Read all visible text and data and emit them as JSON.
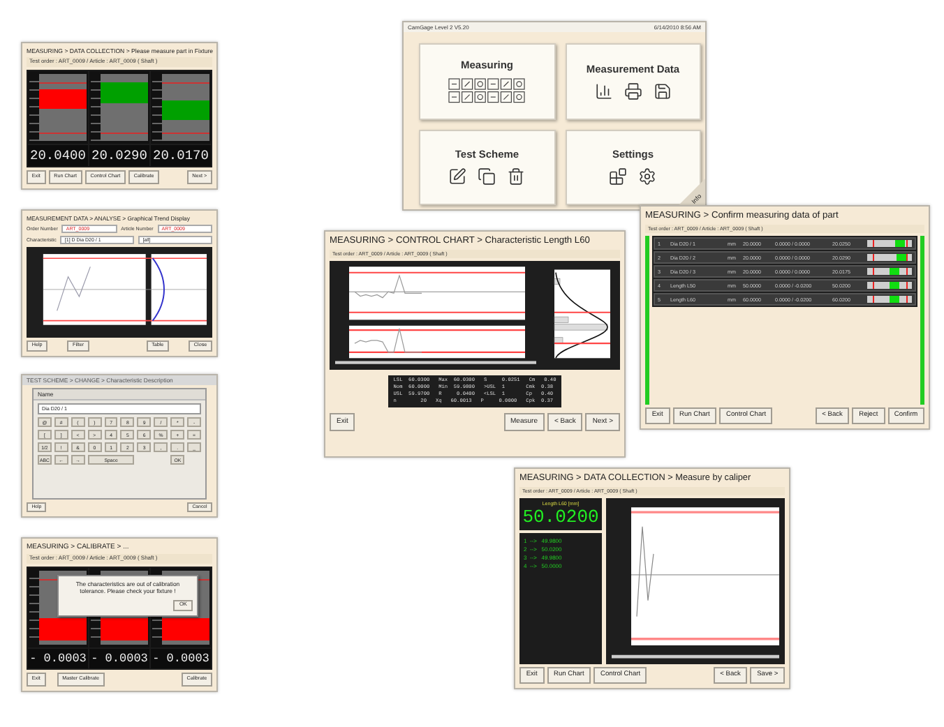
{
  "gauge_window": {
    "title": "MEASURING > DATA COLLECTION > Please measure part in Fixture",
    "order_line": "Test order : ART_0009 / Article : ART_0009 ( Shaft )",
    "gauges": [
      {
        "value": "20.0400",
        "color": "#ff0000",
        "level": 0.62
      },
      {
        "value": "20.0290",
        "color": "#00a000",
        "level": 0.72
      },
      {
        "value": "20.0170",
        "color": "#00a000",
        "level": 0.46
      }
    ],
    "buttons": [
      "Exit",
      "Run Chart",
      "Control Chart",
      "Calibrate",
      "Next >"
    ]
  },
  "main_menu": {
    "title": "CamGage Level 2  V5.20",
    "datetime": "6/14/2010  8:56 AM",
    "tiles": [
      {
        "kind": "measuring",
        "label": "Measuring"
      },
      {
        "kind": "data",
        "label": "Measurement Data"
      },
      {
        "kind": "scheme",
        "label": "Test Scheme"
      },
      {
        "kind": "settings",
        "label": "Settings"
      }
    ],
    "info": "Info"
  },
  "trend_window": {
    "title": "MEASUREMENT DATA > ANALYSE > Graphical Trend Display",
    "order_label": "Order Number",
    "order_value": "ART_0009",
    "article_label": "Article Number",
    "article_value": "ART_0009",
    "characteristic_label": "Characteristic",
    "characteristic_value": "[1] D Dia D20 / 1",
    "filter_value": "[all]",
    "buttons": [
      "Help",
      "Filter",
      "Table",
      "Close"
    ]
  },
  "control_chart": {
    "title": "MEASURING > CONTROL CHART > Characteristic Length L60",
    "order_line": "Test order : ART_0009 / Article : ART_0009 ( Shaft )",
    "stats": [
      "LSL  60.0300   Max  60.0300   S     0.0251   Cm   0.40",
      "Nom  60.0000   Min  59.9800   >USL  1       Cmk  0.38",
      "USL  59.9700   R     0.0400   <LSL  1       Cp   0.40",
      "n        20   Xq   60.0013   P     0.0000   Cpk  0.37"
    ],
    "buttons": [
      "Exit",
      "Measure",
      "< Back",
      "Next >"
    ]
  },
  "confirm": {
    "title": "MEASURING >  Confirm measuring data of part",
    "order_line": "Test order : ART_0009 / Article : ART_0009 ( Shaft )",
    "rows": [
      {
        "number": "1",
        "name": "Dia D20 / 1",
        "unit": "mm",
        "nominal": "20.0000",
        "tolerance": "0.0000 / 0.0000",
        "value": "20.0250",
        "level": 0.72
      },
      {
        "number": "2",
        "name": "Dia D20 / 2",
        "unit": "mm",
        "nominal": "20.0000",
        "tolerance": "0.0000 / 0.0000",
        "value": "20.0290",
        "level": 0.78
      },
      {
        "number": "3",
        "name": "Dia D20 / 3",
        "unit": "mm",
        "nominal": "20.0000",
        "tolerance": "0.0000 / 0.0000",
        "value": "20.0175",
        "level": 0.6
      },
      {
        "number": "4",
        "name": "Length L50",
        "unit": "mm",
        "nominal": "50.0000",
        "tolerance": "0.0000 / -0.0200",
        "value": "50.0200",
        "level": 0.62
      },
      {
        "number": "5",
        "name": "Length L60",
        "unit": "mm",
        "nominal": "60.0000",
        "tolerance": "0.0000 / -0.0200",
        "value": "60.0200",
        "level": 0.62
      }
    ],
    "buttons": [
      "Exit",
      "Run Chart",
      "Control Chart",
      "< Back",
      "Reject",
      "Confirm"
    ]
  },
  "keyboard_window": {
    "title": "TEST SCHEME > CHANGE > Characteristic Description",
    "dialog_title": "Name",
    "input": "Dia D20 / 1",
    "keys": [
      [
        "@",
        "#",
        "(",
        ")",
        "7",
        "8",
        "9",
        "/",
        "*",
        "-"
      ],
      [
        "[",
        "]",
        "<",
        ">",
        "4",
        "5",
        "6",
        "%",
        "+",
        "="
      ],
      [
        "1/2",
        "!",
        "&",
        "0",
        "1",
        "2",
        "3",
        ",",
        ".",
        "_"
      ]
    ],
    "bottom_keys": [
      "ABC",
      "←",
      "→",
      "Space"
    ],
    "ok": "OK",
    "buttons": [
      "Help",
      "Cancel"
    ]
  },
  "caliper": {
    "title": "MEASURING >  DATA COLLECTION >  Measure by caliper",
    "order_line": "Test order : ART_0009 / Article : ART_0009 ( Shaft )",
    "reading_label": "Length L60 [mm]",
    "reading": "50.0200",
    "measurements": [
      "1  -->   49.9800",
      "2  -->   50.0200",
      "3  -->   49.9800",
      "4  -->   50.0000"
    ],
    "buttons": [
      "Exit",
      "Run Chart",
      "Control Chart",
      "< Back",
      "Save >"
    ]
  },
  "calibrate": {
    "title": "MEASURING > CALIBRATE > ...",
    "order_line": "Test order : ART_0009 / Article : ART_0009 ( Shaft )",
    "gauges": [
      {
        "value": "- 0.0003",
        "color": "#ff0000",
        "level": 0.2
      },
      {
        "value": "- 0.0003",
        "color": "#ff0000",
        "level": 0.2
      },
      {
        "value": "- 0.0003",
        "color": "#ff0000",
        "level": 0.2
      }
    ],
    "message": "The characteristics  are out of calibration tolerance. Please check your fixture !",
    "ok": "OK",
    "buttons": [
      "Exit",
      "Master Calibrate",
      "Calibrate"
    ]
  }
}
